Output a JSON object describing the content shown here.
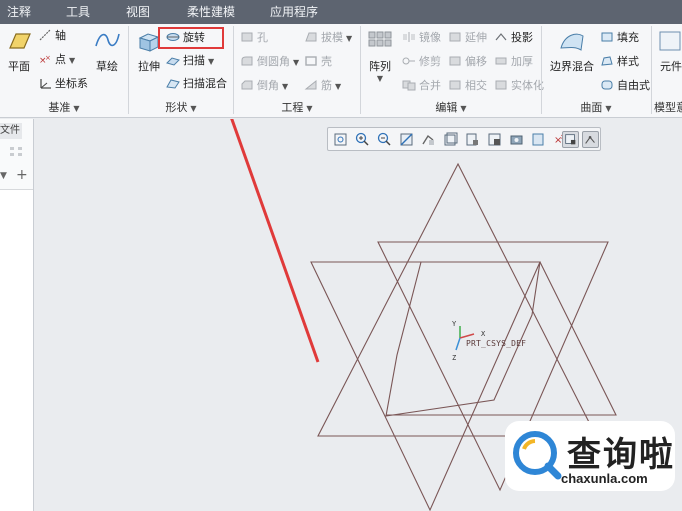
{
  "tabs": [
    {
      "label": "注释",
      "active": false
    },
    {
      "label": "工具",
      "active": false
    },
    {
      "label": "视图",
      "active": false
    },
    {
      "label": "柔性建模",
      "active": false
    },
    {
      "label": "应用程序",
      "active": false
    }
  ],
  "ribbon": {
    "datum": {
      "label": "基准",
      "plane": "平面",
      "axis": "轴",
      "point": "点",
      "csys": "坐标系",
      "sketch": "草绘"
    },
    "shapes": {
      "label": "形状",
      "extrude": "拉伸",
      "revolve": "旋转",
      "sweep": "扫描",
      "swept_blend": "扫描混合"
    },
    "engineering": {
      "label": "工程",
      "hole": "孔",
      "draft": "拔模",
      "round": "倒圆角",
      "shell": "壳",
      "chamfer": "倒角",
      "rib": "筋"
    },
    "editing": {
      "label": "编辑",
      "pattern": "阵列",
      "mirror": "镜像",
      "extend": "延伸",
      "project": "投影",
      "trim": "修剪",
      "offset": "偏移",
      "thicken": "加厚",
      "merge": "合并",
      "intersect": "相交",
      "solidify": "实体化"
    },
    "surfaces": {
      "label": "曲面",
      "boundary_blend": "边界混合",
      "fill": "填充",
      "style": "样式",
      "freestyle": "自由式"
    },
    "model_intent": {
      "label": "模型意",
      "component": "元件"
    }
  },
  "left_panel": {
    "tab": "文件夹"
  },
  "canvas": {
    "csys_name": "PRT_CSYS_DEF",
    "axis_x": "X",
    "axis_y": "Y",
    "axis_z": "Z"
  },
  "watermark": {
    "title": "查询啦",
    "site": "chaxunla.com"
  },
  "colors": {
    "highlight_box": "#e03a3a",
    "sketch_lines": "#7a5656"
  }
}
